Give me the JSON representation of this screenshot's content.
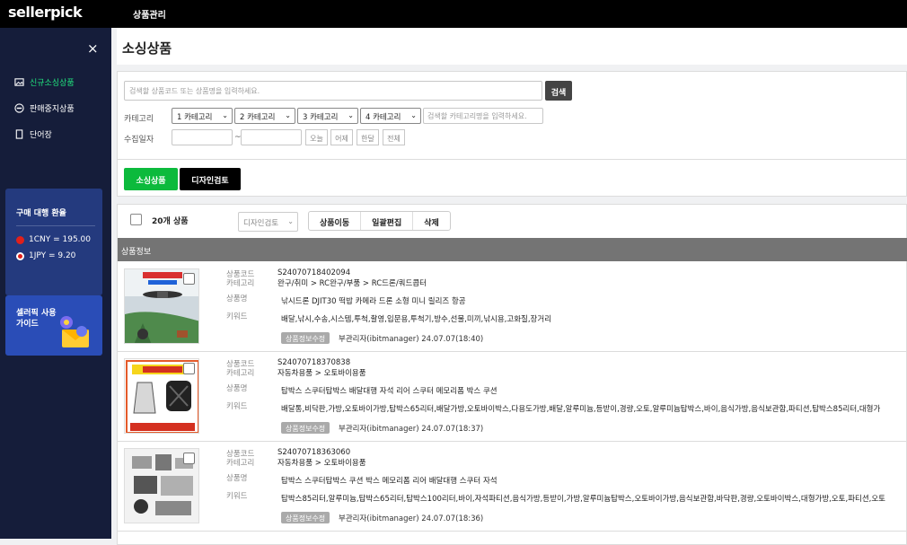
{
  "topbar": {
    "logo": "sellerpick",
    "nav": "상품관리"
  },
  "sidebar": {
    "close": "×",
    "items": [
      {
        "label": "신규소싱상품",
        "icon": "image-icon",
        "active": true
      },
      {
        "label": "판매중지상품",
        "icon": "stop-icon",
        "active": false
      },
      {
        "label": "단어장",
        "icon": "book-icon",
        "active": false
      }
    ],
    "rate": {
      "title": "구매 대행 환율",
      "cny": "1CNY = 195.00",
      "jpy": "1JPY = 9.20"
    },
    "guide": {
      "title": "셀러픽 사용가이드"
    }
  },
  "page": {
    "title": "소싱상품"
  },
  "search": {
    "placeholder": "검색할 상품코드 또는 상품명을 입력하세요.",
    "button": "검색",
    "category_label": "카테고리",
    "cat1": "1 카테고리",
    "cat2": "2 카테고리",
    "cat3": "3 카테고리",
    "cat4": "4 카테고리",
    "cat_placeholder": "검색할 카테고리명을 입력하세요.",
    "date_label": "수집일자",
    "tilde": "~",
    "today": "오늘",
    "yesterday": "어제",
    "week": "한달",
    "all": "전체"
  },
  "tabs": {
    "sourcing": "소싱상품",
    "design": "디자인검토"
  },
  "list": {
    "count": "20개 상품",
    "filter": "디자인검토",
    "move": "상품이동",
    "bulk": "일괄편집",
    "delete": "삭제",
    "header": "상품정보",
    "labels": {
      "code": "상품코드",
      "category": "카테고리",
      "name": "상품명",
      "keyword": "키워드"
    },
    "edit_label": "상품정보수정",
    "rows": [
      {
        "code": "S24070718402094",
        "category": "완구/취미 > RC완구/부품 > RC드론/쿼드콥터",
        "name": "낚시드론 DJIT30 떡밥 카메라 드론 소형 미니 릴리즈 항공",
        "keyword": "배달,낚시,수송,시스템,투척,촬영,입문용,투척기,방수,선물,미끼,낚시용,고화질,장거리",
        "meta": "부관리자(ibitmanager) 24.07.07(18:40)"
      },
      {
        "code": "S24070718370838",
        "category": "자동차용품 > 오토바이용품",
        "name": "탑박스 스쿠터탑박스 배달대행 자석 리어 스쿠터 메모리폼 박스 쿠션",
        "keyword": "배달통,비닥판,가방,오토바이가방,탑박스65리터,배달가방,오토바이박스,다용도가방,배달,알루미늄,등받이,경량,오토,알루미늄탑박스,바이,음식가방,음식보관함,파티션,탑박스85리터,대형가",
        "meta": "부관리자(ibitmanager) 24.07.07(18:37)"
      },
      {
        "code": "S24070718363060",
        "category": "자동차용품 > 오토바이용품",
        "name": "탑박스 스쿠터탑박스 쿠션 박스 메모리폼 리어 배달대행 스쿠터 자석",
        "keyword": "탑박스85리터,알루미늄,탑박스65리터,탑박스100리터,바이,자석파티션,음식가방,등받이,가방,알루미늄탑박스,오토바이가방,음식보관함,바닥판,경량,오토바이박스,대형가방,오토,파티션,오토",
        "meta": "부관리자(ibitmanager) 24.07.07(18:36)"
      }
    ]
  }
}
